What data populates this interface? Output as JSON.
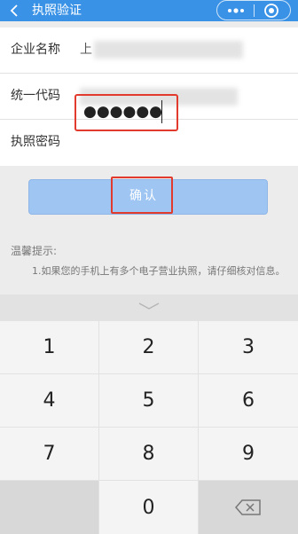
{
  "header": {
    "title": "执照验证",
    "back_icon": "back-chevron-icon",
    "more_icon": "more-dots-icon",
    "close_icon": "close-target-icon",
    "bg_color": "#3a92e6"
  },
  "form": {
    "company_name": {
      "label": "企业名称",
      "value": "上"
    },
    "credit_code": {
      "label": "统一代码"
    },
    "password": {
      "label": "执照密码",
      "value": "●●●●●●"
    }
  },
  "confirm": {
    "label": "确认"
  },
  "tips": {
    "title": "温馨提示:",
    "text": "1.如果您的手机上有多个电子营业执照，请仔细核对信息。"
  },
  "keyboard": {
    "keys": [
      "1",
      "2",
      "3",
      "4",
      "5",
      "6",
      "7",
      "8",
      "9",
      "0"
    ],
    "collapse_icon": "chevron-down-icon",
    "backspace_icon": "backspace-icon"
  },
  "colors": {
    "highlight": "#e23b2e",
    "button": "#9fc6f3"
  }
}
